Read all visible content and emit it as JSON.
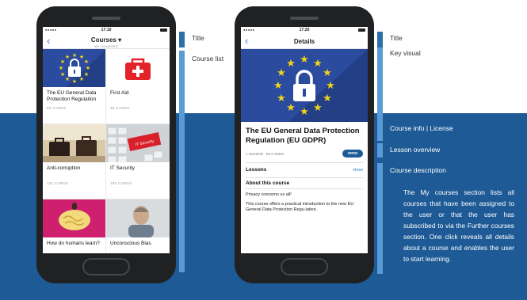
{
  "colors": {
    "band": "#1e5a95",
    "accent": "#2f7fd1",
    "annot_bar": "#5b9bd5",
    "eu_blue": "#2b4b9e",
    "eu_star": "#f3d21a",
    "firstaid_red": "#e2242a"
  },
  "left_phone": {
    "status": {
      "signal": "●●●●●",
      "time": "17:10"
    },
    "nav": {
      "back_icon": "chevron-left-icon",
      "title": "Courses ▾",
      "subtitle": "MY COURSES"
    },
    "courses": [
      {
        "title": "The EU General Data Protection Regulation",
        "count": "50 CARDS"
      },
      {
        "title": "First Aid",
        "count": "35 CARDS"
      },
      {
        "title": "Anti-corruption",
        "count": "121 CARDS"
      },
      {
        "title": "IT Security",
        "count": "155 CARDS",
        "thumb_label": "IT Security"
      },
      {
        "title": "How do humans learn?",
        "count": ""
      },
      {
        "title": "Unconscious Bias",
        "count": ""
      }
    ]
  },
  "right_phone": {
    "status": {
      "signal": "●●●●●",
      "time": "17:20"
    },
    "nav": {
      "back_icon": "chevron-left-icon",
      "title": "Details"
    },
    "course_title": "The EU General Data Protection Regulation (EU GDPR)",
    "meta": "1 LESSON · 50 CARDS",
    "open_label": "OPEN",
    "lessons_label": "Lessons",
    "show_label": "show",
    "about_heading": "About this course",
    "about_p1": "Privacy concerns us all!",
    "about_p2": "This course offers a practical introduction to the new EU General Data Protection Regu-lation."
  },
  "annotations": {
    "left": {
      "title": "Title",
      "course_list": "Course list"
    },
    "right": {
      "title": "Title",
      "key_visual": "Key visual",
      "course_info": "Course info | License",
      "lesson_overview": "Lesson overview",
      "course_description": "Course description"
    },
    "description": "The My courses section lists all courses that have been assigned to the user or that the user has subscribed to via the Further courses section. One click reveals all details about a course and enables the user to start learning."
  }
}
